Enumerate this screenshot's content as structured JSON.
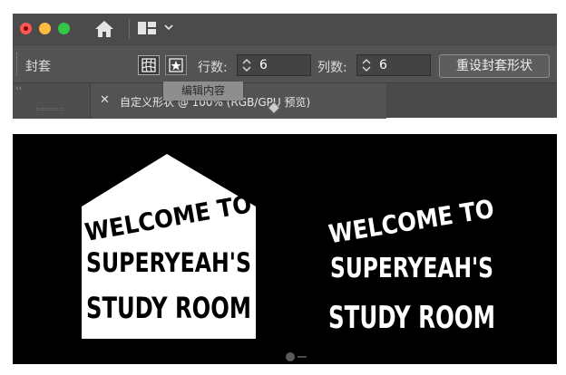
{
  "toolbar": {
    "mode_label": "封套",
    "rows_label": "行数:",
    "rows_value": "6",
    "cols_label": "列数:",
    "cols_value": "6",
    "reset_label": "重设封套形状"
  },
  "document": {
    "tab_title": "自定义形状 @ 100% (RGB/GPU 预览)",
    "tooltip": "编辑内容"
  },
  "artwork": {
    "left": {
      "lines": [
        "WELCOME TO",
        "SUPERYEAH'S",
        "STUDY ROOM"
      ]
    },
    "right": {
      "lines": [
        "WELCOME TO",
        "SUPERYEAH'S",
        "STUDY ROOM"
      ]
    }
  },
  "colors": {
    "close": "#fc5753",
    "minimize": "#fdbc40",
    "zoom": "#33c748",
    "panel": "#535353",
    "canvas": "#000000"
  },
  "icons": [
    "home-icon",
    "layout-icon",
    "chevron-down-icon",
    "mesh-warp-icon",
    "envelope-warp-icon",
    "spinner-icon",
    "close-icon"
  ]
}
